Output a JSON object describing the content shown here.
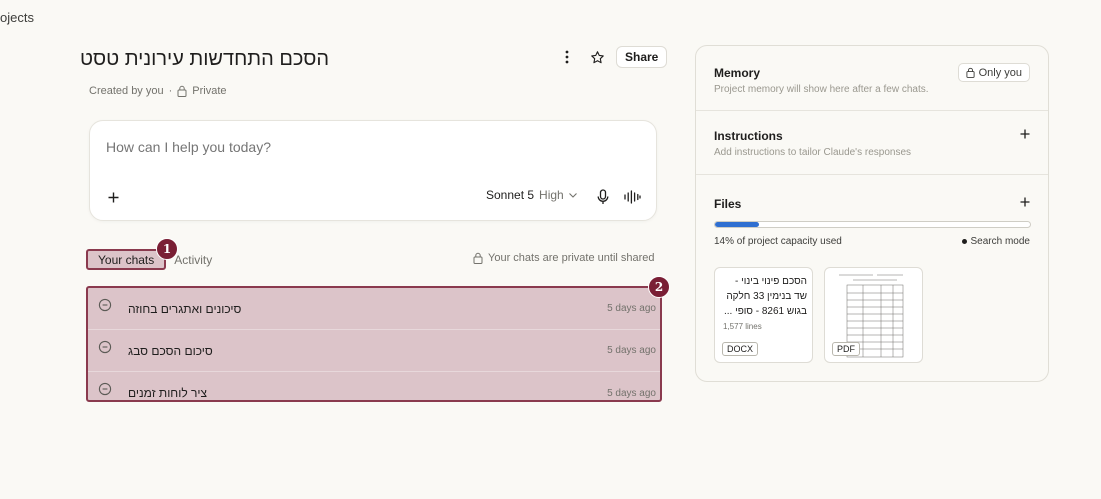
{
  "breadcrumb": "ojects",
  "project": {
    "title": "הסכם התחדשות עירונית טסט",
    "created_by": "Created by you",
    "separator": "·",
    "visibility": "Private"
  },
  "actions": {
    "more_icon": "more-vertical-icon",
    "star_icon": "star-icon",
    "share_label": "Share"
  },
  "composer": {
    "placeholder": "How can I help you today?",
    "add_icon": "plus-icon",
    "model": "Sonnet 5",
    "effort": "High",
    "mic_icon": "microphone-icon",
    "voice_icon": "voice-waveform-icon"
  },
  "tabs": {
    "your_chats": "Your chats",
    "activity": "Activity",
    "privacy_note": "Your chats are private until shared"
  },
  "badges": [
    "1",
    "2"
  ],
  "chats": [
    {
      "title": "סיכונים ואתגרים בחוזה",
      "time": "5 days ago"
    },
    {
      "title": "סיכום הסכם סבג",
      "time": "5 days ago"
    },
    {
      "title": "ציר לוחות זמנים",
      "time": "5 days ago"
    }
  ],
  "side_panel": {
    "memory": {
      "title": "Memory",
      "subtitle": "Project memory will show here after a few chats.",
      "only_you": "Only you"
    },
    "instructions": {
      "title": "Instructions",
      "subtitle": "Add instructions to tailor Claude's responses"
    },
    "files": {
      "title": "Files",
      "capacity_percent": 14,
      "capacity_label": "14% of project capacity used",
      "search_mode": "Search mode",
      "items": [
        {
          "title": "הסכם פינוי בינוי - שד בנימין 33 חלקה בגוש 8261 - סופי ...",
          "lines": "1,577 lines",
          "type": "DOCX"
        },
        {
          "type": "PDF"
        }
      ]
    }
  },
  "colors": {
    "highlight_fill": "#dcc4c9",
    "highlight_border": "#8a3a4e",
    "badge": "#7a1f35",
    "capacity_fill": "#2f6fd1"
  }
}
